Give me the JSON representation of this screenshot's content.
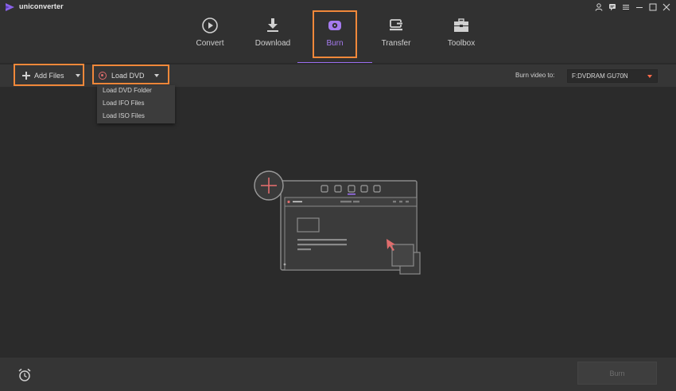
{
  "app": {
    "name": "uniconverter"
  },
  "colors": {
    "accent": "#9a6df0",
    "highlight": "#f0883a",
    "disc": "#e06d6d"
  },
  "window_controls": [
    {
      "name": "user-icon"
    },
    {
      "name": "feedback-icon"
    },
    {
      "name": "menu-icon"
    },
    {
      "name": "minimize-icon"
    },
    {
      "name": "maximize-icon"
    },
    {
      "name": "close-icon"
    }
  ],
  "nav": {
    "items": [
      {
        "label": "Convert",
        "icon": "play-circle-icon"
      },
      {
        "label": "Download",
        "icon": "download-icon"
      },
      {
        "label": "Burn",
        "icon": "disc-burn-icon",
        "active": true
      },
      {
        "label": "Transfer",
        "icon": "transfer-icon"
      },
      {
        "label": "Toolbox",
        "icon": "toolbox-icon"
      }
    ]
  },
  "toolbar": {
    "add_files_label": "Add Files",
    "load_dvd_label": "Load DVD",
    "burn_to_label": "Burn video to:",
    "burn_to_value": "F:DVDRAM GU70N"
  },
  "dropdown": {
    "items": [
      "Load DVD Folder",
      "Load IFO Files",
      "Load ISO Files"
    ]
  },
  "bottom": {
    "burn_label": "Burn",
    "burn_enabled": false
  }
}
